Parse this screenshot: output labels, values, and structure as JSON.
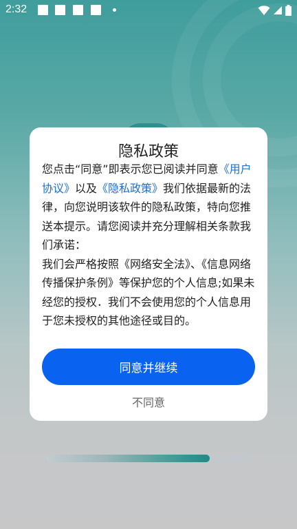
{
  "status_bar": {
    "time": "2:32",
    "notification_icons": [
      "square-notification-icon",
      "square-notification-icon",
      "square-notification-icon",
      "square-notification-icon"
    ],
    "dot_icon": "dot-icon",
    "wifi_icon": "wifi-icon",
    "signal_icon": "signal-icon",
    "battery_icon": "battery-icon"
  },
  "privacy_dialog": {
    "title": "隐私政策",
    "paragraph1": {
      "intro": "您点击“同意”即表示您已阅读并同意",
      "user_agreement_link": "《用户协议》",
      "conjunction": "以及",
      "privacy_policy_link": "《隐私政策》",
      "rest": "我们依据最新的法律，向您说明该软件的隐私政策，特向您推送本提示。请您阅读并充分理解相关条款我们承诺："
    },
    "paragraph2": "我们会严格按照《网络安全法》、《信息网络传播保护条例》等保护您的个人信息;如果未经您的授权．我们不会使用您的个人信息用于您未授权的其他途径或目的。",
    "agree_button_label": "同意并继续",
    "disagree_button_label": "不同意"
  },
  "loading": {
    "progress": 0.8
  },
  "colors": {
    "primary_button": "#0a62f0",
    "link": "#1a6fd8",
    "background_top": "#3f9d9c",
    "background_bottom": "#c7c7c8",
    "progress_fill": "#1e8a86"
  }
}
